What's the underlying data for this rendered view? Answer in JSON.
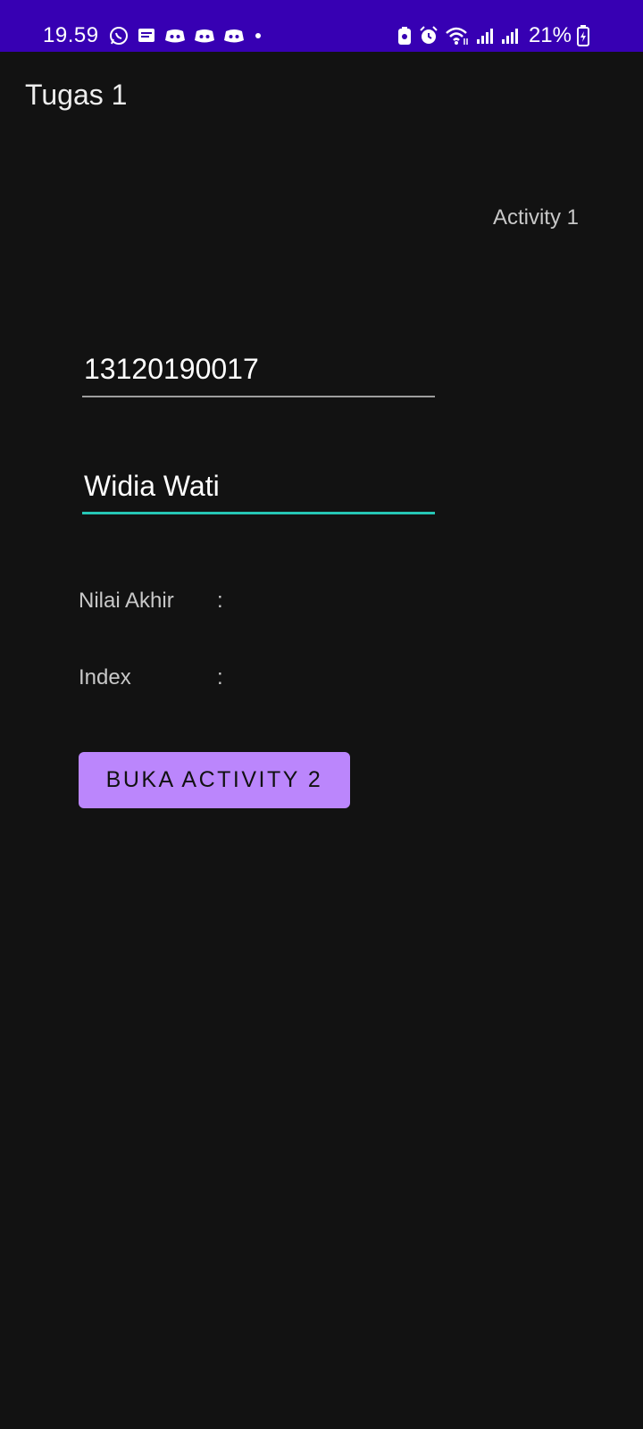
{
  "status_bar": {
    "time": "19.59",
    "battery": "21%",
    "left_icons": [
      "whatsapp-icon",
      "message-icon",
      "discord-icon",
      "discord-icon",
      "discord-icon",
      "dot-icon"
    ],
    "right_icons": [
      "battery-saver-icon",
      "alarm-icon",
      "wifi-icon",
      "signal-icon",
      "signal-icon",
      "battery-icon"
    ],
    "color": "#3700b3"
  },
  "appbar": {
    "title": "Tugas 1"
  },
  "main": {
    "activity_label": "Activity 1",
    "nim_field": {
      "value": "13120190017"
    },
    "name_field": {
      "value": "Widia Wati"
    },
    "nilai_akhir": {
      "label": "Nilai Akhir",
      "colon": ":"
    },
    "index": {
      "label": "Index",
      "colon": ":"
    },
    "open_button": {
      "label": "BUKA ACTIVITY 2"
    }
  },
  "colors": {
    "background": "#121212",
    "accent": "#bb86fc",
    "focus_underline": "#26c6b5"
  }
}
